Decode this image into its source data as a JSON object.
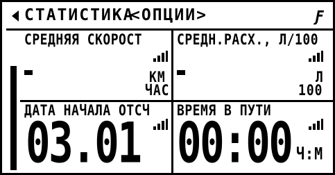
{
  "header": {
    "title": "СТАТИСТИКА",
    "options_label": "<ОПЦИИ>"
  },
  "cells": {
    "avg_speed": {
      "label": "СРЕДНЯЯ СКОРОСТ",
      "unit_top": "КМ",
      "unit_bottom": "ЧАС"
    },
    "avg_consumption": {
      "label": "СРЕДН.РАСХ., Л/100",
      "unit_top": "Л",
      "unit_bottom": "100"
    },
    "trip_start": {
      "label": "ДАТА НАЧАЛА ОТСЧ",
      "value": "03.01"
    },
    "travel_time": {
      "label": "ВРЕМЯ В ПУТИ",
      "value": "00:00",
      "unit": "Ч:М"
    }
  },
  "icons": {
    "back": "left-arrow-icon",
    "battery": "battery-icon",
    "signal": "signal-bars-icon",
    "dash": "no-value-dash-icon"
  },
  "colors": {
    "foreground": "#000000",
    "background": "#ffffff"
  }
}
